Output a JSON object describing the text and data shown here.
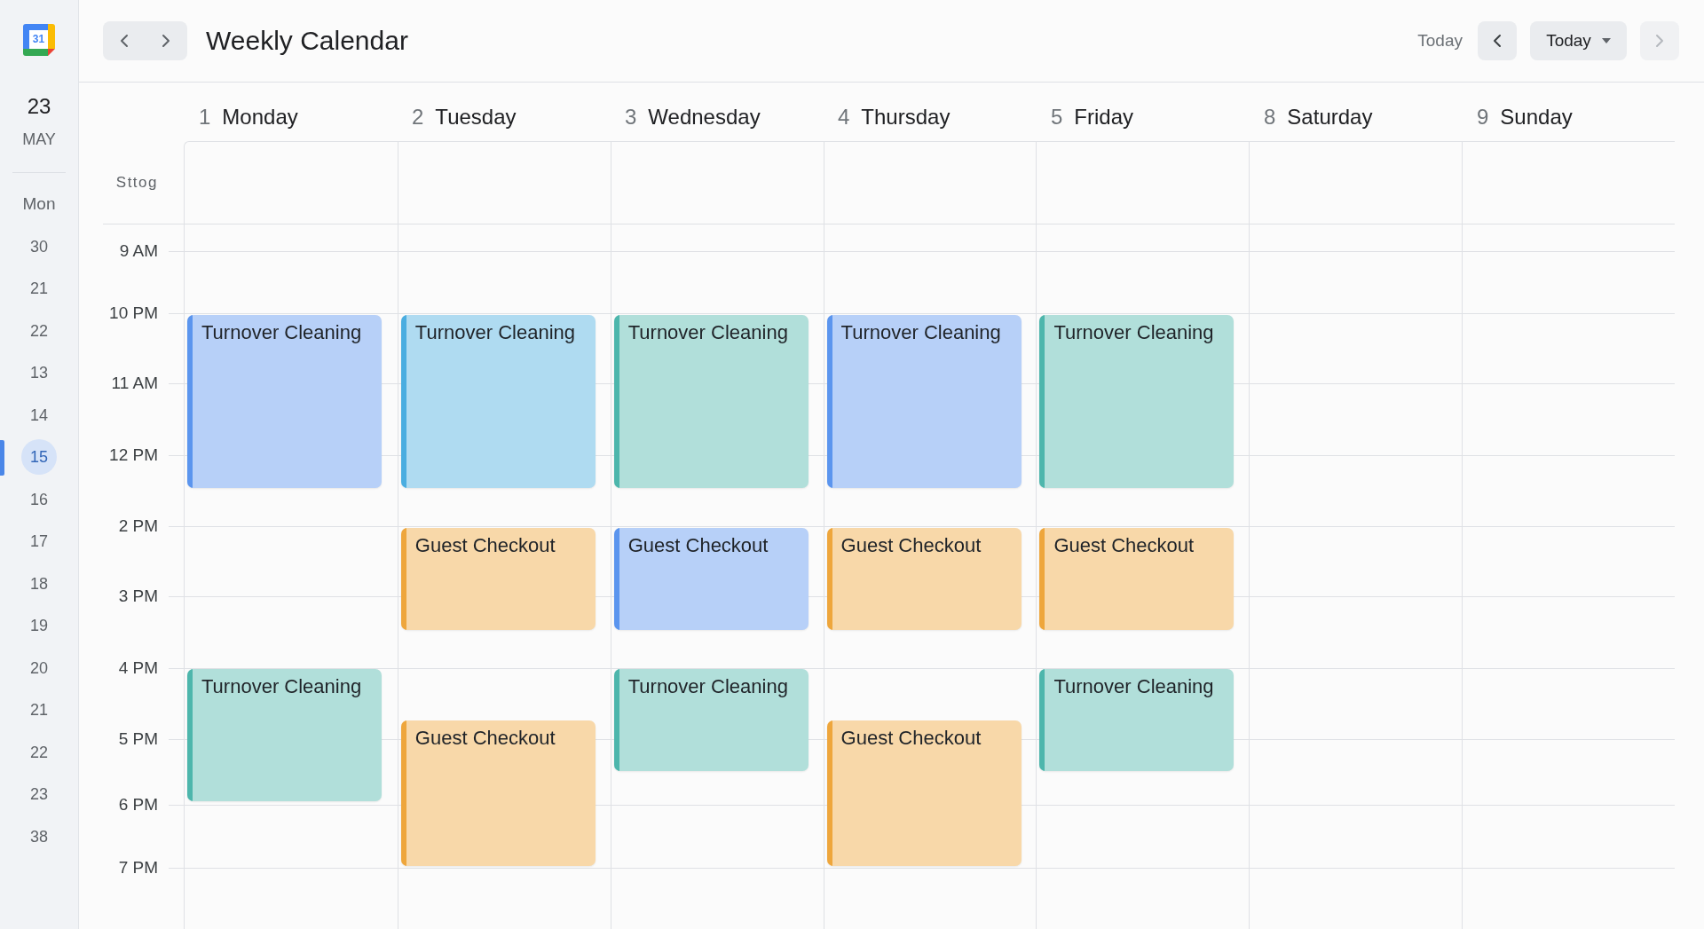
{
  "sidebar": {
    "logo_text": "31",
    "day": "23",
    "month": "MAY",
    "weekday": "Mon",
    "dates": [
      {
        "label": "30",
        "selected": false
      },
      {
        "label": "21",
        "selected": false
      },
      {
        "label": "22",
        "selected": false
      },
      {
        "label": "13",
        "selected": false
      },
      {
        "label": "14",
        "selected": false
      },
      {
        "label": "15",
        "selected": true
      },
      {
        "label": "16",
        "selected": false
      },
      {
        "label": "17",
        "selected": false
      },
      {
        "label": "18",
        "selected": false
      },
      {
        "label": "19",
        "selected": false
      },
      {
        "label": "20",
        "selected": false
      },
      {
        "label": "21",
        "selected": false
      },
      {
        "label": "22",
        "selected": false
      },
      {
        "label": "23",
        "selected": false
      },
      {
        "label": "38",
        "selected": false
      }
    ]
  },
  "header": {
    "title": "Weekly Calendar",
    "today_label": "Today",
    "prev_button": {
      "disabled": false
    },
    "view_dropdown": {
      "label": "Today"
    },
    "next_button": {
      "disabled": true
    }
  },
  "calendar": {
    "all_day_label": "Sttog",
    "time_labels": [
      "9 AM",
      "10 PM",
      "11 AM",
      "12 PM",
      "2 PM",
      "3 PM",
      "4 PM",
      "5 PM",
      "6 PM",
      "7 PM"
    ],
    "days": [
      {
        "number": "1",
        "name": "Monday",
        "events": [
          {
            "title": "Turnover Cleaning",
            "color": "#5b95ee"
          },
          {
            "title": "Turnover Cleaning",
            "color": "#4db6ac"
          }
        ]
      },
      {
        "number": "2",
        "name": "Tuesday",
        "events": [
          {
            "title": "Turnover Cleaning",
            "color": "#4aade0"
          },
          {
            "title": "Guest Checkout",
            "color": "#eea63c"
          },
          {
            "title": "Guest Checkout",
            "color": "#eea63c"
          }
        ]
      },
      {
        "number": "3",
        "name": "Wednesday",
        "events": [
          {
            "title": "Turnover Cleaning",
            "color": "#4db6ac"
          },
          {
            "title": "Guest Checkout",
            "color": "#5b95ee"
          },
          {
            "title": "Turnover Cleaning",
            "color": "#4db6ac"
          }
        ]
      },
      {
        "number": "4",
        "name": "Thursday",
        "events": [
          {
            "title": "Turnover Cleaning",
            "color": "#5b95ee"
          },
          {
            "title": "Guest Checkout",
            "color": "#eea63c"
          },
          {
            "title": "Guest Checkout",
            "color": "#eea63c"
          }
        ]
      },
      {
        "number": "5",
        "name": "Friday",
        "events": [
          {
            "title": "Turnover Cleaning",
            "color": "#4db6ac"
          },
          {
            "title": "Guest Checkout",
            "color": "#eea63c"
          },
          {
            "title": "Turnover Cleaning",
            "color": "#4db6ac"
          }
        ]
      },
      {
        "number": "8",
        "name": "Saturday"
      },
      {
        "number": "9",
        "name": "Sunday"
      }
    ]
  }
}
